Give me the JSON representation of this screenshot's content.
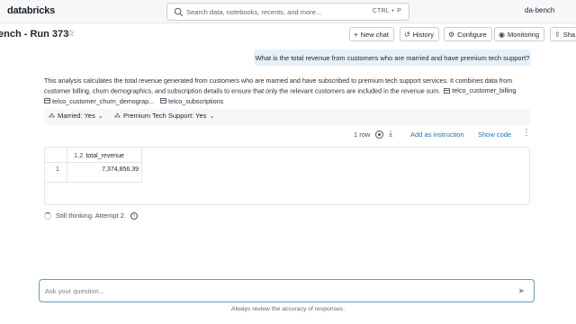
{
  "topbar": {
    "logo": "databricks",
    "search_placeholder": "Search data, notebooks, recents, and more...",
    "search_shortcut": "CTRL + P",
    "user": "da-bench"
  },
  "titlebar": {
    "title": "ench - Run 373",
    "buttons": [
      {
        "label": "New chat",
        "icon": "plus-icon"
      },
      {
        "label": "History",
        "icon": "history-icon"
      },
      {
        "label": "Configure",
        "icon": "gear-icon"
      },
      {
        "label": "Monitoring",
        "icon": "eye-icon"
      },
      {
        "label": "Sha",
        "icon": "share-icon"
      }
    ]
  },
  "chat": {
    "user_question": "What is the total revenue from customers who are married and have premium tech support?",
    "answer_text": "This analysis calculates the total revenue generated from customers who are married and have subscribed to premium tech support services. It combines data from customer billing, churn demographics, and subscription details to ensure that only the relevant customers are included in the revenue sum.",
    "tables": [
      "telco_customer_billing",
      "telco_customer_churn_demograp...",
      "telco_subscriptions"
    ],
    "filters": [
      {
        "label": "Married: Yes"
      },
      {
        "label": "Premium Tech Support: Yes"
      }
    ]
  },
  "result": {
    "row_count": "1 row",
    "add_instruction": "Add as instruction",
    "show_code": "Show code",
    "column": {
      "type": "1.2",
      "name": "total_revenue"
    },
    "rows": [
      {
        "index": "1",
        "value": "7,374,856.39"
      }
    ]
  },
  "status": {
    "text": "Still thinking. Attempt 2."
  },
  "input": {
    "placeholder": "Ask your question...",
    "disclaimer": "Always review the accuracy of responses."
  },
  "colors": {
    "accent_link": "#2272b4",
    "bubble_bg": "#e5f0fb",
    "input_border": "#5aa3b4"
  }
}
